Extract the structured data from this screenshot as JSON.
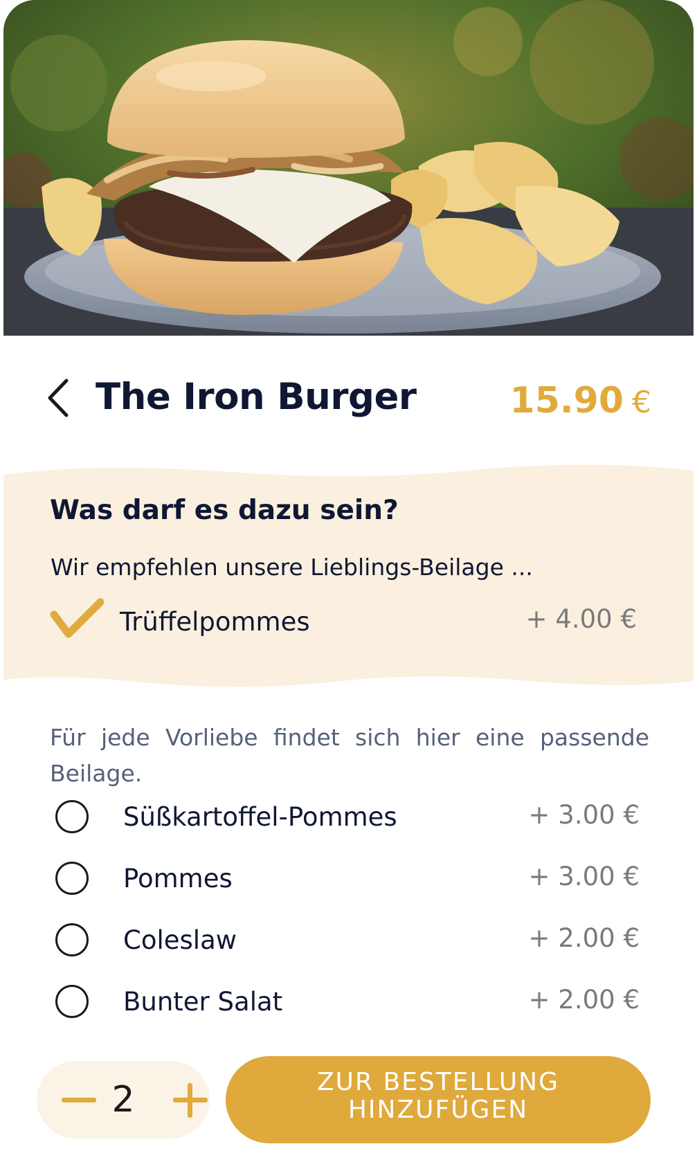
{
  "product": {
    "name": "The Iron Burger",
    "price": "15.90",
    "currency": "€",
    "image_alt": "burger with chips"
  },
  "recommendation": {
    "heading": "Was darf es dazu sein?",
    "subtitle": "Wir empfehlen unsere Lieblings-Beilage ...",
    "option": {
      "label": "Trüffelpommes",
      "price": "+ 4.00 €",
      "selected": true
    }
  },
  "sides": {
    "intro": "Für jede Vorliebe findet sich hier eine passende Beilage.",
    "options": [
      {
        "label": "Süßkartoffel-Pommes",
        "price": "+ 3.00 €",
        "selected": false
      },
      {
        "label": "Pommes",
        "price": "+ 3.00 €",
        "selected": false
      },
      {
        "label": "Coleslaw",
        "price": "+ 2.00 €",
        "selected": false
      },
      {
        "label": "Bunter Salat",
        "price": "+ 2.00 €",
        "selected": false
      }
    ]
  },
  "quantity": {
    "value": "2"
  },
  "actions": {
    "add_to_order_label": "ZUR BESTELLUNG\nHINZUFÜGEN"
  },
  "icons": {
    "back": "chevron-left-icon",
    "check": "checkmark-icon",
    "minus": "minus-icon",
    "plus": "plus-icon"
  },
  "colors": {
    "accent": "#e0ab3c",
    "text_dark": "#0f1733",
    "panel_cream": "#fbf0df",
    "muted_price": "#7a7a7a",
    "muted_text": "#55607a"
  }
}
